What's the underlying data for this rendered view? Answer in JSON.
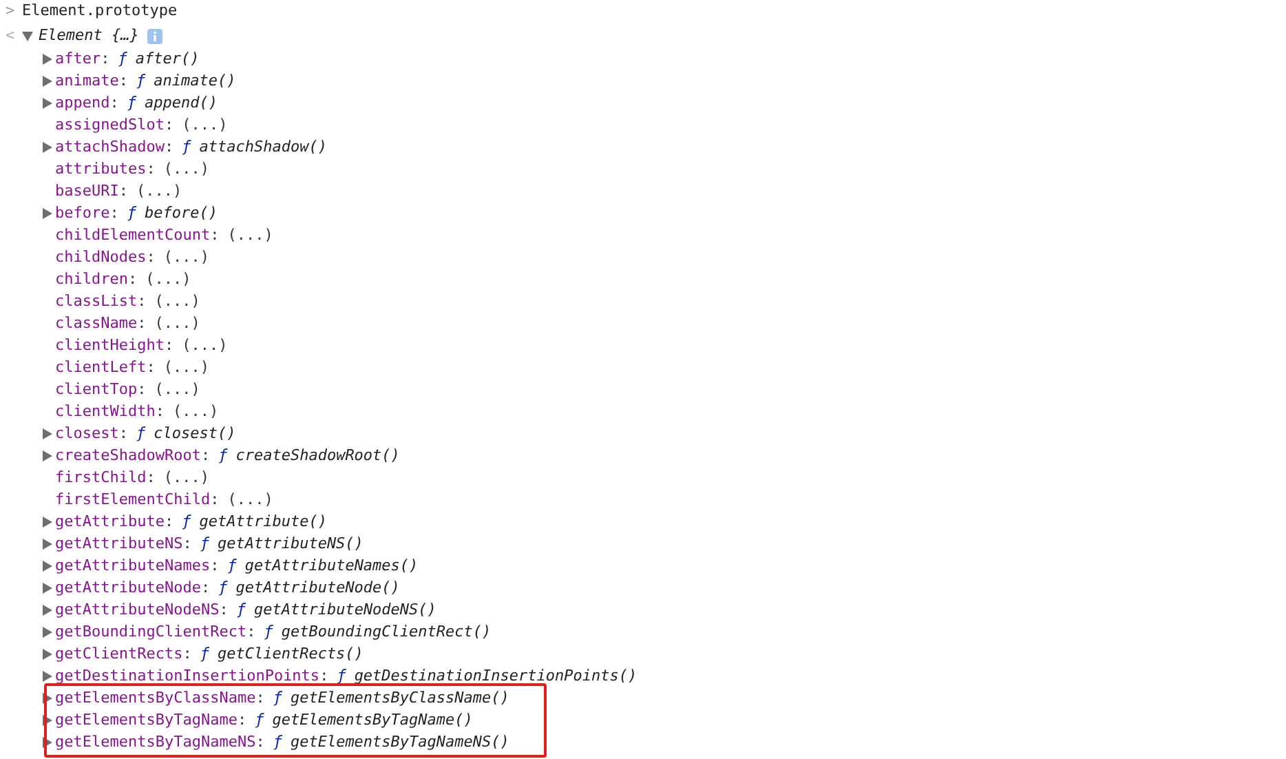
{
  "input": {
    "prompt": ">",
    "text": "Element.prototype"
  },
  "result": {
    "prompt": "<",
    "expanded": true,
    "label": "Element {…}",
    "properties": [
      {
        "name": "after",
        "separator": ":",
        "type_mark": "ƒ",
        "value": "after()",
        "expandable": true,
        "highlighted": false
      },
      {
        "name": "animate",
        "separator": ":",
        "type_mark": "ƒ",
        "value": "animate()",
        "expandable": true,
        "highlighted": false
      },
      {
        "name": "append",
        "separator": ":",
        "type_mark": "ƒ",
        "value": "append()",
        "expandable": true,
        "highlighted": false
      },
      {
        "name": "assignedSlot",
        "separator": ":",
        "value": "(...)",
        "expandable": false,
        "highlighted": false
      },
      {
        "name": "attachShadow",
        "separator": ":",
        "type_mark": "ƒ",
        "value": "attachShadow()",
        "expandable": true,
        "highlighted": false
      },
      {
        "name": "attributes",
        "separator": ":",
        "value": "(...)",
        "expandable": false,
        "highlighted": false
      },
      {
        "name": "baseURI",
        "separator": ":",
        "value": "(...)",
        "expandable": false,
        "highlighted": false
      },
      {
        "name": "before",
        "separator": ":",
        "type_mark": "ƒ",
        "value": "before()",
        "expandable": true,
        "highlighted": false
      },
      {
        "name": "childElementCount",
        "separator": ":",
        "value": "(...)",
        "expandable": false,
        "highlighted": false
      },
      {
        "name": "childNodes",
        "separator": ":",
        "value": "(...)",
        "expandable": false,
        "highlighted": false
      },
      {
        "name": "children",
        "separator": ":",
        "value": "(...)",
        "expandable": false,
        "highlighted": false
      },
      {
        "name": "classList",
        "separator": ":",
        "value": "(...)",
        "expandable": false,
        "highlighted": false
      },
      {
        "name": "className",
        "separator": ":",
        "value": "(...)",
        "expandable": false,
        "highlighted": false
      },
      {
        "name": "clientHeight",
        "separator": ":",
        "value": "(...)",
        "expandable": false,
        "highlighted": false
      },
      {
        "name": "clientLeft",
        "separator": ":",
        "value": "(...)",
        "expandable": false,
        "highlighted": false
      },
      {
        "name": "clientTop",
        "separator": ":",
        "value": "(...)",
        "expandable": false,
        "highlighted": false
      },
      {
        "name": "clientWidth",
        "separator": ":",
        "value": "(...)",
        "expandable": false,
        "highlighted": false
      },
      {
        "name": "closest",
        "separator": ":",
        "type_mark": "ƒ",
        "value": "closest()",
        "expandable": true,
        "highlighted": false
      },
      {
        "name": "createShadowRoot",
        "separator": ":",
        "type_mark": "ƒ",
        "value": "createShadowRoot()",
        "expandable": true,
        "highlighted": false
      },
      {
        "name": "firstChild",
        "separator": ":",
        "value": "(...)",
        "expandable": false,
        "highlighted": false
      },
      {
        "name": "firstElementChild",
        "separator": ":",
        "value": "(...)",
        "expandable": false,
        "highlighted": false
      },
      {
        "name": "getAttribute",
        "separator": ":",
        "type_mark": "ƒ",
        "value": "getAttribute()",
        "expandable": true,
        "highlighted": false
      },
      {
        "name": "getAttributeNS",
        "separator": ":",
        "type_mark": "ƒ",
        "value": "getAttributeNS()",
        "expandable": true,
        "highlighted": false
      },
      {
        "name": "getAttributeNames",
        "separator": ":",
        "type_mark": "ƒ",
        "value": "getAttributeNames()",
        "expandable": true,
        "highlighted": false
      },
      {
        "name": "getAttributeNode",
        "separator": ":",
        "type_mark": "ƒ",
        "value": "getAttributeNode()",
        "expandable": true,
        "highlighted": false
      },
      {
        "name": "getAttributeNodeNS",
        "separator": ":",
        "type_mark": "ƒ",
        "value": "getAttributeNodeNS()",
        "expandable": true,
        "highlighted": false
      },
      {
        "name": "getBoundingClientRect",
        "separator": ":",
        "type_mark": "ƒ",
        "value": "getBoundingClientRect()",
        "expandable": true,
        "highlighted": false
      },
      {
        "name": "getClientRects",
        "separator": ":",
        "type_mark": "ƒ",
        "value": "getClientRects()",
        "expandable": true,
        "highlighted": false
      },
      {
        "name": "getDestinationInsertionPoints",
        "separator": ":",
        "type_mark": "ƒ",
        "value": "getDestinationInsertionPoints()",
        "expandable": true,
        "highlighted": false
      },
      {
        "name": "getElementsByClassName",
        "separator": ":",
        "type_mark": "ƒ",
        "value": "getElementsByClassName()",
        "expandable": true,
        "highlighted": true
      },
      {
        "name": "getElementsByTagName",
        "separator": ":",
        "type_mark": "ƒ",
        "value": "getElementsByTagName()",
        "expandable": true,
        "highlighted": true
      },
      {
        "name": "getElementsByTagNameNS",
        "separator": ":",
        "type_mark": "ƒ",
        "value": "getElementsByTagNameNS()",
        "expandable": true,
        "highlighted": true
      }
    ]
  }
}
